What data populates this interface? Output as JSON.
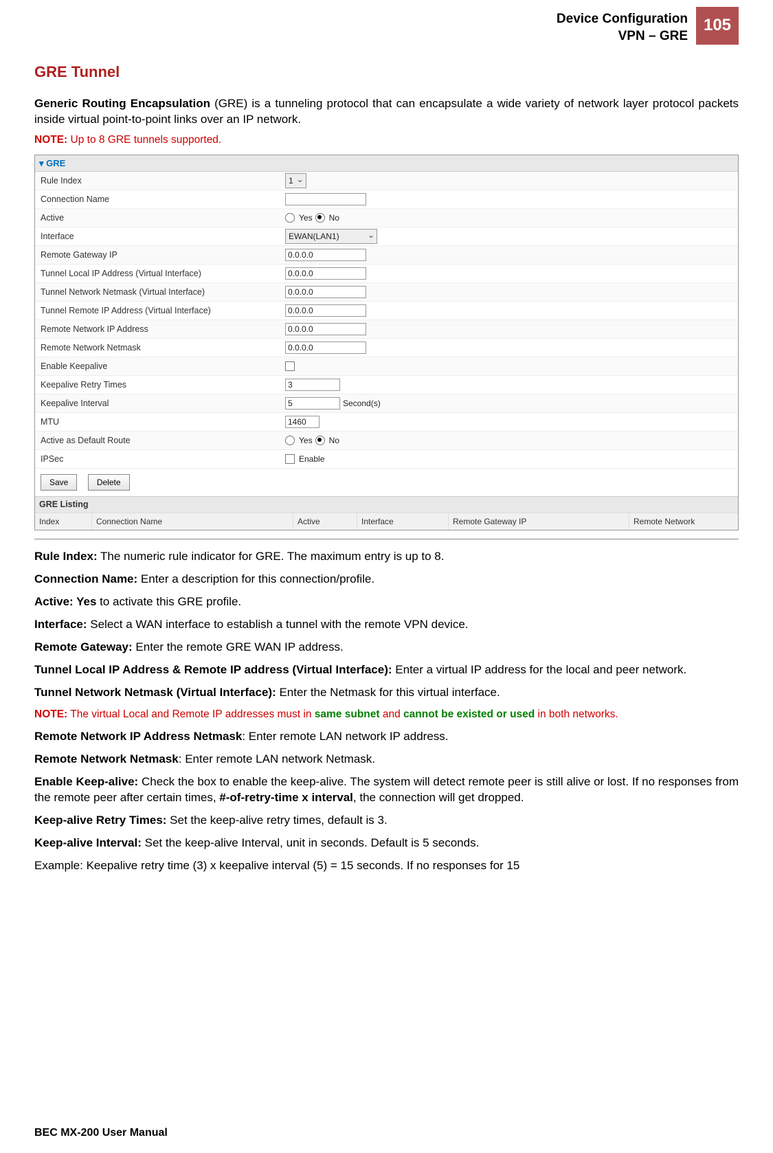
{
  "header": {
    "line1": "Device Configuration",
    "line2": "VPN – GRE",
    "page_num": "105"
  },
  "title": "GRE Tunnel",
  "intro": {
    "bold": "Generic Routing Encapsulation",
    "rest": " (GRE) is a tunneling protocol that can encapsulate a wide variety of network layer protocol packets inside virtual point-to-point links over an IP network."
  },
  "note1": {
    "label": "NOTE:",
    "text": " Up to 8 GRE tunnels supported."
  },
  "form": {
    "panel_title": "GRE",
    "rows": {
      "rule_index": {
        "label": "Rule Index",
        "value": "1"
      },
      "conn_name": {
        "label": "Connection Name",
        "value": ""
      },
      "active": {
        "label": "Active",
        "yes": "Yes",
        "no": "No"
      },
      "interface": {
        "label": "Interface",
        "value": "EWAN(LAN1)"
      },
      "remote_gw": {
        "label": "Remote Gateway IP",
        "value": "0.0.0.0"
      },
      "tun_local": {
        "label": "Tunnel Local IP Address (Virtual Interface)",
        "value": "0.0.0.0"
      },
      "tun_netmask": {
        "label": "Tunnel Network Netmask (Virtual Interface)",
        "value": "0.0.0.0"
      },
      "tun_remote": {
        "label": "Tunnel Remote IP Address (Virtual Interface)",
        "value": "0.0.0.0"
      },
      "rem_net_ip": {
        "label": "Remote Network IP Address",
        "value": "0.0.0.0"
      },
      "rem_net_mask": {
        "label": "Remote Network Netmask",
        "value": "0.0.0.0"
      },
      "keepalive": {
        "label": "Enable Keepalive"
      },
      "retry": {
        "label": "Keepalive Retry Times",
        "value": "3"
      },
      "interval": {
        "label": "Keepalive Interval",
        "value": "5",
        "unit": "Second(s)"
      },
      "mtu": {
        "label": "MTU",
        "value": "1460"
      },
      "def_route": {
        "label": "Active as Default Route",
        "yes": "Yes",
        "no": "No"
      },
      "ipsec": {
        "label": "IPSec",
        "opt": "Enable"
      }
    },
    "buttons": {
      "save": "Save",
      "delete": "Delete"
    },
    "listing": {
      "title": "GRE Listing",
      "cols": [
        "Index",
        "Connection Name",
        "Active",
        "Interface",
        "Remote Gateway IP",
        "Remote Network"
      ]
    }
  },
  "defs": {
    "rule_index": {
      "b": "Rule Index:",
      "t": " The numeric rule indicator for GRE.  The maximum entry is up to 8."
    },
    "conn_name": {
      "b": "Connection Name:",
      "t": " Enter a description for this connection/profile."
    },
    "active": {
      "b": "Active: Yes",
      "t": " to activate this GRE profile."
    },
    "interface": {
      "b": "Interface:",
      "t": " Select a WAN interface to establish a tunnel with the remote VPN device."
    },
    "remote_gw": {
      "b": "Remote Gateway:",
      "t": " Enter the remote GRE WAN IP address."
    },
    "tun_ip": {
      "b": "Tunnel Local IP Address & Remote IP address (Virtual Interface):",
      "t": " Enter a virtual IP address for the local and peer network."
    },
    "tun_mask": {
      "b": "Tunnel Network Netmask (Virtual Interface):",
      "t": " Enter the Netmask for this virtual interface."
    },
    "rem_ip": {
      "b": "Remote Network IP Address Netmask",
      "t": ": Enter remote LAN network IP address."
    },
    "rem_mask": {
      "b": "Remote Network Netmask",
      "t": ": Enter remote LAN network Netmask."
    },
    "keepalive": {
      "b": "Enable Keep-alive:",
      "t1": " Check the box to enable the keep-alive. The system will detect remote peer is still alive or lost. If no responses from the remote peer after certain times, ",
      "b2": "#-of-retry-time x interval",
      "t2": ", the connection will get dropped."
    },
    "retry": {
      "b": "Keep-alive Retry Times:",
      "t": " Set the keep-alive retry times, default is 3."
    },
    "interval": {
      "b": "Keep-alive Interval:",
      "t": " Set the keep-alive Interval, unit in seconds. Default is 5 seconds."
    },
    "example": "Example: Keepalive retry time (3) x keepalive interval (5) = 15 seconds.  If no responses for 15"
  },
  "note2": {
    "label": "NOTE:",
    "t1": " The virtual Local and Remote IP addresses must in ",
    "g1": "same subnet",
    "t2": " and ",
    "g2": "cannot be existed or used",
    "t3": " in both networks."
  },
  "footer": "BEC MX-200 User Manual"
}
